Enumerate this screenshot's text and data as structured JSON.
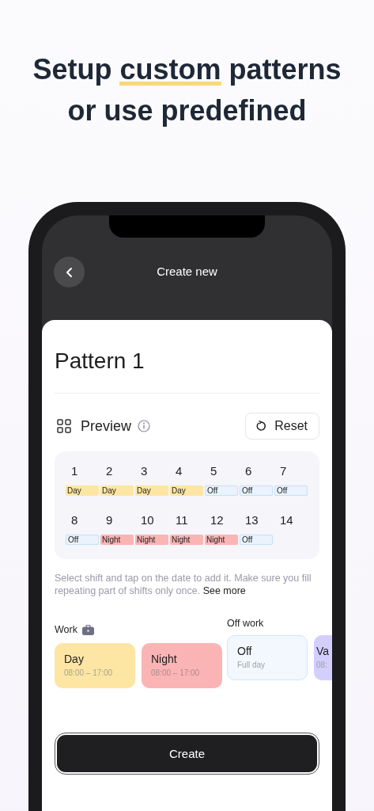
{
  "headline": {
    "before": "Setup",
    "highlight": "custom",
    "after": "patterns or use predefined"
  },
  "header": {
    "title": "Create new"
  },
  "pattern_name": "Pattern 1",
  "preview": {
    "title": "Preview",
    "reset_label": "Reset"
  },
  "days": [
    {
      "date": "1",
      "shift": "Day",
      "kind": "day"
    },
    {
      "date": "2",
      "shift": "Day",
      "kind": "day"
    },
    {
      "date": "3",
      "shift": "Day",
      "kind": "day"
    },
    {
      "date": "4",
      "shift": "Day",
      "kind": "day"
    },
    {
      "date": "5",
      "shift": "Off",
      "kind": "off"
    },
    {
      "date": "6",
      "shift": "Off",
      "kind": "off"
    },
    {
      "date": "7",
      "shift": "Off",
      "kind": "off"
    },
    {
      "date": "8",
      "shift": "Off",
      "kind": "off"
    },
    {
      "date": "9",
      "shift": "Night",
      "kind": "night"
    },
    {
      "date": "10",
      "shift": "Night",
      "kind": "night"
    },
    {
      "date": "11",
      "shift": "Night",
      "kind": "night"
    },
    {
      "date": "12",
      "shift": "Night",
      "kind": "night"
    },
    {
      "date": "13",
      "shift": "Off",
      "kind": "off"
    },
    {
      "date": "14"
    }
  ],
  "hint": {
    "text": "Select shift and tap on the date to add it. Make sure you fill repeating part of shifts only once.",
    "link": "See more"
  },
  "groups": [
    {
      "label": "Work",
      "shifts": [
        {
          "name": "Day",
          "time": "08:00 – 17:00",
          "kind": "day"
        },
        {
          "name": "Night",
          "time": "08:00 – 17:00",
          "kind": "night"
        }
      ]
    },
    {
      "label": "Off work",
      "shifts": [
        {
          "name": "Off",
          "time": "Full day",
          "kind": "off"
        },
        {
          "name": "Va",
          "time": "08:",
          "kind": "vacation"
        }
      ]
    }
  ],
  "create_label": "Create"
}
